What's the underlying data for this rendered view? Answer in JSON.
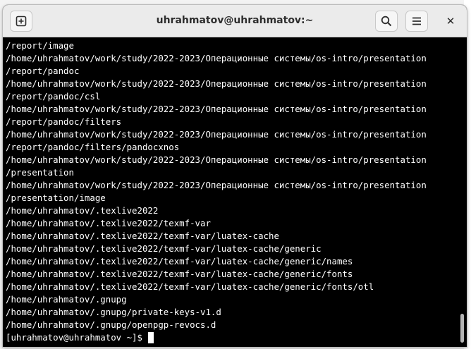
{
  "window": {
    "title": "uhrahmatov@uhrahmatov:~",
    "icons": {
      "new_tab": "new-tab-plus-icon",
      "search": "search-icon",
      "menu": "hamburger-menu-icon",
      "close": "close-icon"
    },
    "close_glyph": "✕"
  },
  "colors": {
    "terminal_bg": "#000000",
    "terminal_fg": "#ffffff",
    "titlebar_bg": "#ebebeb"
  },
  "terminal": {
    "lines": [
      "/report/image",
      "/home/uhrahmatov/work/study/2022-2023/Операционные системы/os-intro/presentation",
      "/report/pandoc",
      "/home/uhrahmatov/work/study/2022-2023/Операционные системы/os-intro/presentation",
      "/report/pandoc/csl",
      "/home/uhrahmatov/work/study/2022-2023/Операционные системы/os-intro/presentation",
      "/report/pandoc/filters",
      "/home/uhrahmatov/work/study/2022-2023/Операционные системы/os-intro/presentation",
      "/report/pandoc/filters/pandocxnos",
      "/home/uhrahmatov/work/study/2022-2023/Операционные системы/os-intro/presentation",
      "/presentation",
      "/home/uhrahmatov/work/study/2022-2023/Операционные системы/os-intro/presentation",
      "/presentation/image",
      "/home/uhrahmatov/.texlive2022",
      "/home/uhrahmatov/.texlive2022/texmf-var",
      "/home/uhrahmatov/.texlive2022/texmf-var/luatex-cache",
      "/home/uhrahmatov/.texlive2022/texmf-var/luatex-cache/generic",
      "/home/uhrahmatov/.texlive2022/texmf-var/luatex-cache/generic/names",
      "/home/uhrahmatov/.texlive2022/texmf-var/luatex-cache/generic/fonts",
      "/home/uhrahmatov/.texlive2022/texmf-var/luatex-cache/generic/fonts/otl",
      "/home/uhrahmatov/.gnupg",
      "/home/uhrahmatov/.gnupg/private-keys-v1.d",
      "/home/uhrahmatov/.gnupg/openpgp-revocs.d"
    ],
    "prompt": "[uhrahmatov@uhrahmatov ~]$"
  }
}
